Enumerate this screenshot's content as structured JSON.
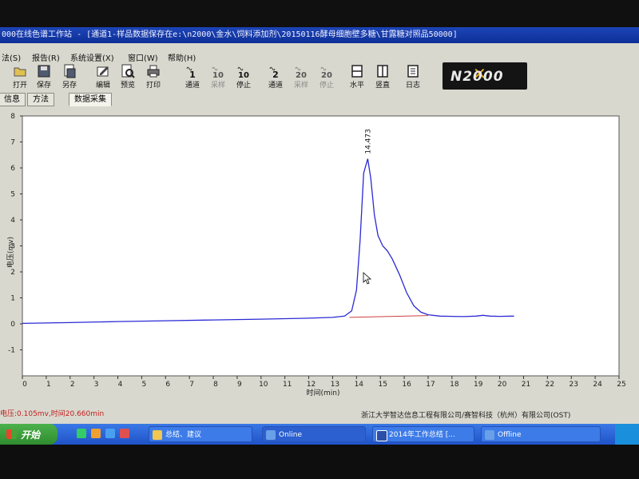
{
  "window": {
    "title": "000在线色谱工作站 - [通道1-样品数据保存在e:\\n2000\\金水\\饲料添加剂\\20150116酵母细胞壁多糖\\甘露糖对照品50000]"
  },
  "menu": [
    "法(S)",
    "报告(R)",
    "系统设置(X)",
    "窗口(W)",
    "帮助(H)"
  ],
  "toolbar": [
    {
      "label": "打开",
      "icon": "folder-open-icon"
    },
    {
      "label": "保存",
      "icon": "save-icon"
    },
    {
      "label": "另存",
      "icon": "save-as-icon"
    },
    {
      "label": "编辑",
      "icon": "edit-icon"
    },
    {
      "label": "预览",
      "icon": "preview-icon"
    },
    {
      "label": "打印",
      "icon": "print-icon"
    },
    {
      "label": "通道",
      "icon": "channel-1-icon",
      "num": "1"
    },
    {
      "label": "采样",
      "icon": "sample-icon",
      "num": "10",
      "disabled": true
    },
    {
      "label": "停止",
      "icon": "stop-icon",
      "num": "10"
    },
    {
      "label": "通道",
      "icon": "channel-2-icon",
      "num": "2"
    },
    {
      "label": "采样",
      "icon": "sample-2-icon",
      "num": "20",
      "disabled": true
    },
    {
      "label": "停止",
      "icon": "stop-2-icon",
      "num": "20",
      "disabled": true
    },
    {
      "label": "水平",
      "icon": "tile-horizontal-icon"
    },
    {
      "label": "竖直",
      "icon": "tile-vertical-icon"
    },
    {
      "label": "日志",
      "icon": "log-icon"
    }
  ],
  "logo": {
    "text": "N2000"
  },
  "tabs": [
    "信息",
    "方法",
    "数据采集"
  ],
  "chart_data": {
    "type": "line",
    "xlabel": "时间(min)",
    "ylabel": "电压(mv)",
    "xlim": [
      0,
      25
    ],
    "ylim": [
      -2,
      8
    ],
    "xticks": [
      0,
      1,
      2,
      3,
      4,
      5,
      6,
      7,
      8,
      9,
      10,
      11,
      12,
      13,
      14,
      15,
      16,
      17,
      18,
      19,
      20,
      21,
      22,
      23,
      24,
      25
    ],
    "yticks": [
      -1,
      0,
      1,
      2,
      3,
      4,
      5,
      6,
      7,
      8
    ],
    "series": [
      {
        "color": "#2a2ad4",
        "x": [
          0,
          2,
          4,
          6,
          8,
          10,
          12,
          13,
          13.5,
          13.8,
          14.0,
          14.15,
          14.3,
          14.47,
          14.6,
          14.75,
          14.9,
          15.1,
          15.3,
          15.5,
          15.8,
          16.1,
          16.4,
          16.7,
          17.0,
          17.5,
          18,
          18.5,
          19,
          19.3,
          19.6,
          20,
          20.6
        ],
        "y": [
          0.02,
          0.05,
          0.09,
          0.12,
          0.15,
          0.18,
          0.22,
          0.25,
          0.3,
          0.5,
          1.3,
          3.2,
          5.8,
          6.35,
          5.6,
          4.2,
          3.4,
          3.0,
          2.8,
          2.5,
          1.9,
          1.2,
          0.7,
          0.45,
          0.35,
          0.3,
          0.29,
          0.28,
          0.3,
          0.33,
          0.3,
          0.29,
          0.3
        ]
      }
    ],
    "baseline": {
      "color": "#d04040",
      "x": [
        13.7,
        17.0
      ],
      "y": [
        0.25,
        0.32
      ]
    },
    "annotations": [
      {
        "x": 14.47,
        "y": 6.35,
        "text": "14.473"
      }
    ],
    "grid": false
  },
  "status": {
    "left": "电压:0.105mv,时间20.660min",
    "right": "浙江大学智达信息工程有限公司/赛智科技（杭州）有限公司(OST)"
  },
  "taskbar": {
    "start_label": "开始",
    "tasks": [
      {
        "label": "总结、建议"
      },
      {
        "label": "Online"
      },
      {
        "label": "2014年工作总结 [..."
      },
      {
        "label": "Offline"
      }
    ]
  }
}
